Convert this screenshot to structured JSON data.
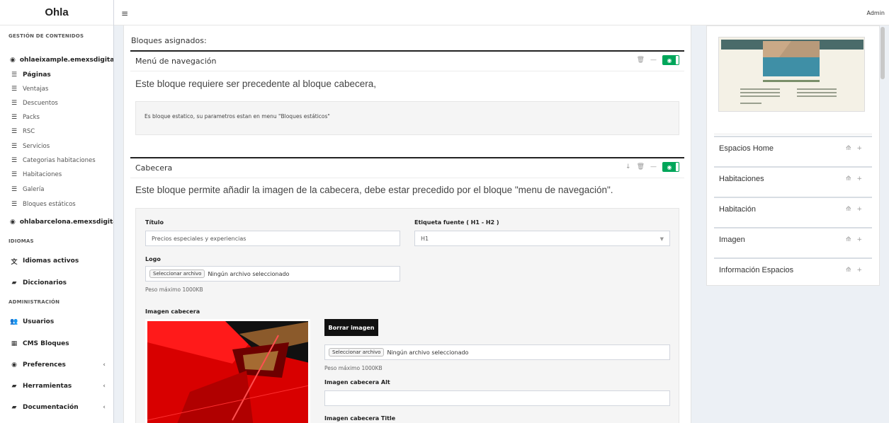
{
  "sidebar": {
    "brand": "Ohla",
    "sections": {
      "contents": "GESTIÓN DE CONTENIDOS",
      "languages": "IDIOMAS",
      "admin": "ADMINISTRACIÓN"
    },
    "site1": "ohlaeixample.emexsdigital.com",
    "site1_items": [
      "Páginas",
      "Ventajas",
      "Descuentos",
      "Packs",
      "RSC",
      "Servicios",
      "Categorias habitaciones",
      "Habitaciones",
      "Galería",
      "Bloques estáticos"
    ],
    "site2": "ohlabarcelona.emexsdigital.com",
    "lang_items": [
      "Idiomas activos",
      "Diccionarios"
    ],
    "admin_items": [
      "Usuarios",
      "CMS Bloques",
      "Preferences",
      "Herramientas",
      "Documentación"
    ]
  },
  "topbar": {
    "menu_icon": "hamburger-icon",
    "user": "Admin"
  },
  "main": {
    "assigned_label": "Bloques asignados:",
    "nav_block": {
      "title": "Menú de navegación",
      "description": "Este bloque requiere ser precedente al bloque cabecera,",
      "note": "Es bloque estatico, su parametros estan en menu \"Bloques estáticos\""
    },
    "header_block": {
      "title": "Cabecera",
      "description": "Este bloque permite añadir la imagen de la cabecera, debe estar precedido por el bloque \"menu de navegación\".",
      "title_label": "Título",
      "title_value": "Precios especiales y experiencias",
      "font_label": "Etiqueta fuente ( H1 - H2 )",
      "font_value": "H1",
      "logo_label": "Logo",
      "file_button": "Seleccionar archivo",
      "no_file": "Ningún archivo seleccionado",
      "max_size": "Peso máximo 1000KB",
      "image_label": "Imagen cabecera",
      "delete_image": "Borrar imagen",
      "alt_label": "Imagen cabecera Alt",
      "alt_value": "",
      "title_attr_label": "Imagen cabecera Title"
    }
  },
  "right_panel": {
    "items": [
      "Espacios Home",
      "Habitaciones",
      "Habitación",
      "Imagen",
      "Información Espacios"
    ]
  },
  "colors": {
    "toggle_on": "#00a65a",
    "dark_button": "#111111",
    "block_border": "#222222"
  }
}
